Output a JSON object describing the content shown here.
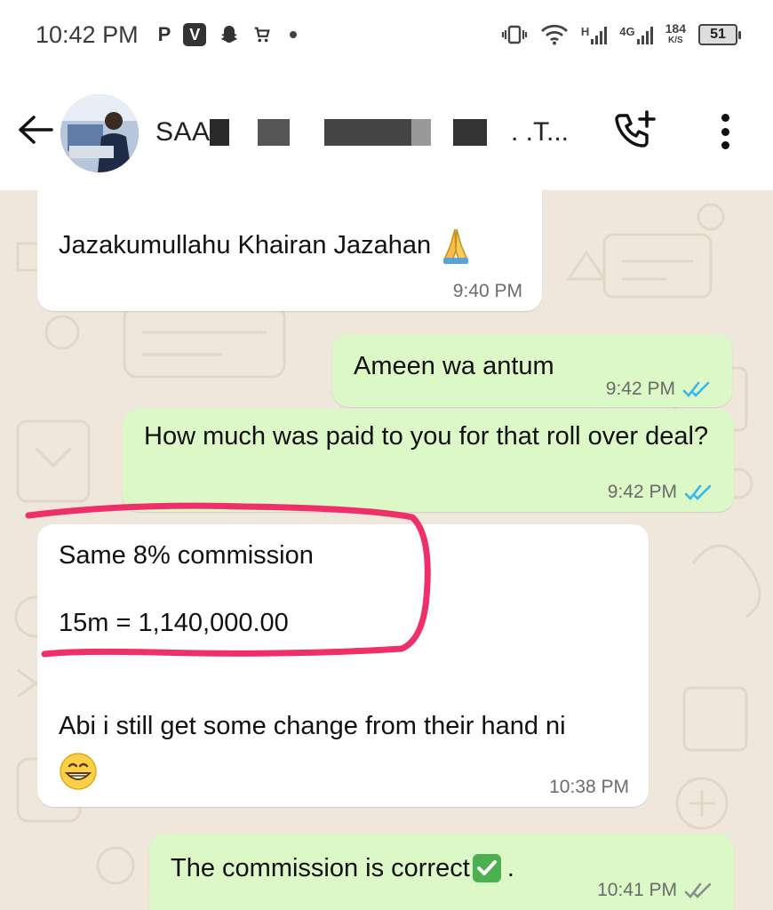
{
  "status_bar": {
    "time": "10:42 PM",
    "apps": [
      "P",
      "V"
    ],
    "network_1": "H",
    "network_2": "4G",
    "speed_value": "184",
    "speed_unit": "K/S",
    "battery": "51"
  },
  "header": {
    "contact_name_prefix": "SAA",
    "contact_name_suffix": ". .T..."
  },
  "messages": [
    {
      "direction": "in",
      "text": "Jazakumullahu Khairan Jazahan",
      "emoji": "folded-hands",
      "time": "9:40 PM"
    },
    {
      "direction": "out",
      "text": "Ameen wa antum",
      "time": "9:42 PM",
      "status": "read"
    },
    {
      "direction": "out",
      "text": "How much was paid to you for that roll over deal?",
      "time": "9:42 PM",
      "status": "read"
    },
    {
      "direction": "in",
      "line1": "Same 8% commission",
      "line2": "15m = 1,140,000.00",
      "line3": "Abi i still get some change from their hand ni",
      "emoji": "grinning-face",
      "time": "10:38 PM"
    },
    {
      "direction": "out",
      "text": "The commission is correct",
      "emoji": "check-mark-button",
      "text_after": ".",
      "time": "10:41 PM",
      "status": "delivered"
    }
  ],
  "colors": {
    "incoming_bubble": "#ffffff",
    "outgoing_bubble": "#dcf8c6",
    "read_ticks": "#34b7f1",
    "delivered_ticks": "#8c8c8c",
    "highlight_stroke": "#ef2f6a"
  }
}
